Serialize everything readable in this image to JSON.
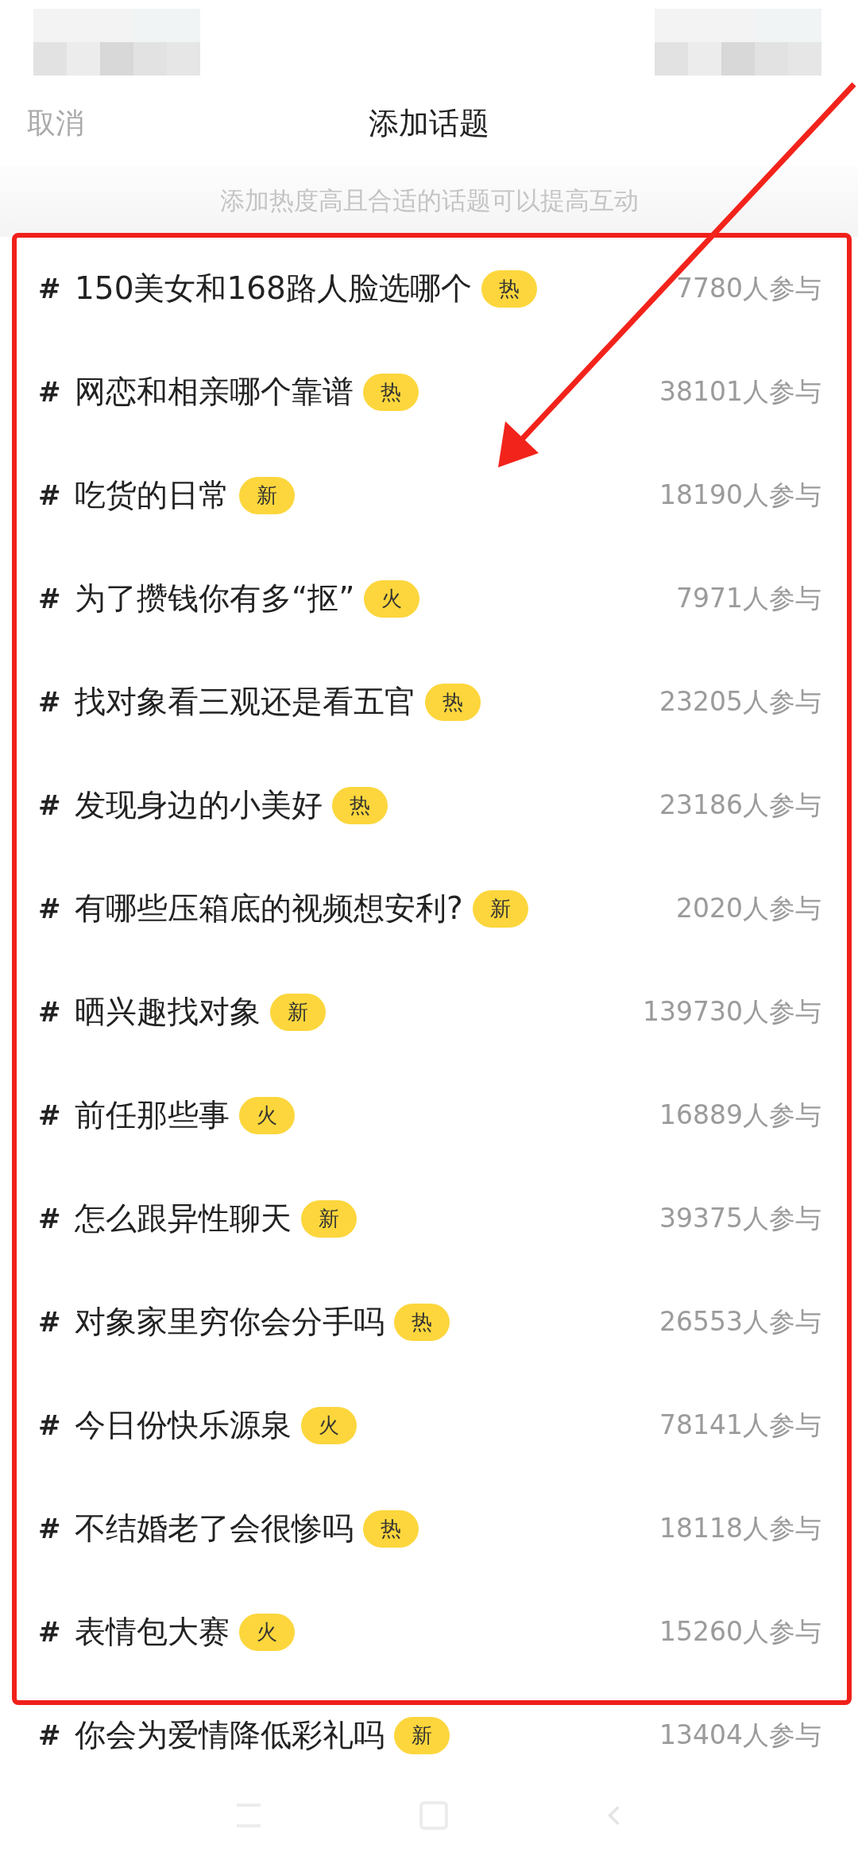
{
  "header": {
    "cancel": "取消",
    "title": "添加话题"
  },
  "hint": "添加热度高且合适的话题可以提高互动",
  "topics": [
    {
      "hash": "#",
      "title": "150美女和168路人脸选哪个",
      "badge": "热",
      "count": "7780人参与"
    },
    {
      "hash": "#",
      "title": "网恋和相亲哪个靠谱",
      "badge": "热",
      "count": "38101人参与"
    },
    {
      "hash": "#",
      "title": "吃货的日常",
      "badge": "新",
      "count": "18190人参与"
    },
    {
      "hash": "#",
      "title": "为了攒钱你有多“抠”",
      "badge": "火",
      "count": "7971人参与"
    },
    {
      "hash": "#",
      "title": "找对象看三观还是看五官",
      "badge": "热",
      "count": "23205人参与"
    },
    {
      "hash": "#",
      "title": "发现身边的小美好",
      "badge": "热",
      "count": "23186人参与"
    },
    {
      "hash": "#",
      "title": "有哪些压箱底的视频想安利?",
      "badge": "新",
      "count": "2020人参与"
    },
    {
      "hash": "#",
      "title": "晒兴趣找对象",
      "badge": "新",
      "count": "139730人参与"
    },
    {
      "hash": "#",
      "title": "前任那些事",
      "badge": "火",
      "count": "16889人参与"
    },
    {
      "hash": "#",
      "title": "怎么跟异性聊天",
      "badge": "新",
      "count": "39375人参与"
    },
    {
      "hash": "#",
      "title": "对象家里穷你会分手吗",
      "badge": "热",
      "count": "26553人参与"
    },
    {
      "hash": "#",
      "title": "今日份快乐源泉",
      "badge": "火",
      "count": "78141人参与"
    },
    {
      "hash": "#",
      "title": "不结婚老了会很惨吗",
      "badge": "热",
      "count": "18118人参与"
    },
    {
      "hash": "#",
      "title": "表情包大赛",
      "badge": "火",
      "count": "15260人参与"
    },
    {
      "hash": "#",
      "title": "你会为爱情降低彩礼吗",
      "badge": "新",
      "count": "13404人参与"
    }
  ],
  "annotation": {
    "frame": true,
    "arrow": true
  }
}
